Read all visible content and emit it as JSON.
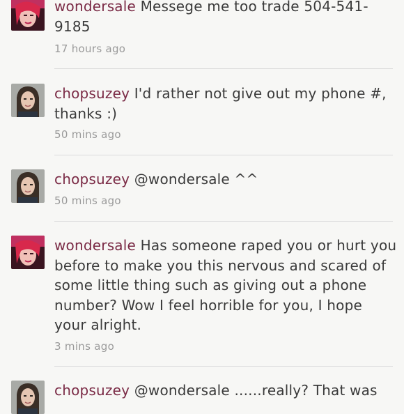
{
  "comments": [
    {
      "user": "wondersale",
      "text": "Messege me too trade 504-541-9185",
      "time": "17 hours ago"
    },
    {
      "user": "chopsuzey",
      "text": "I'd rather not give out my phone #, thanks :)",
      "time": "50 mins ago"
    },
    {
      "user": "chopsuzey",
      "text": "@wondersale ^^",
      "time": "50 mins ago"
    },
    {
      "user": "wondersale",
      "text": "Has someone raped you or hurt you before to make you this nervous and scared of some little thing such as giving out a phone number? Wow I feel horrible for you, I hope your alright.",
      "time": "3 mins ago"
    },
    {
      "user": "chopsuzey",
      "text": "@wondersale ......really? That was",
      "time": ""
    }
  ],
  "colors": {
    "username": "#7a2a45",
    "text": "#3a3a3a",
    "timestamp": "#9a9a9a",
    "divider": "#dcdcdc",
    "background": "#f7f7f5"
  }
}
